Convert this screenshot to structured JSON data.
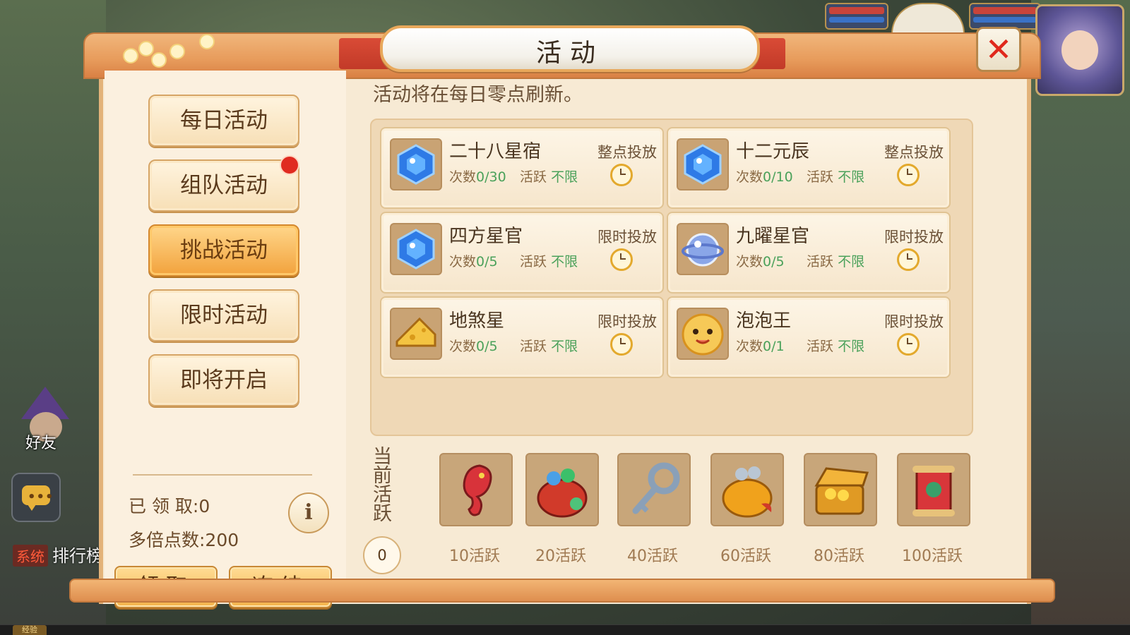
{
  "dialog": {
    "title": "活动",
    "notice": "活动将在每日零点刷新。"
  },
  "sidebar": {
    "tabs": [
      {
        "label": "每日活动",
        "active": false,
        "badge": false
      },
      {
        "label": "组队活动",
        "active": false,
        "badge": true
      },
      {
        "label": "挑战活动",
        "active": true,
        "badge": false
      },
      {
        "label": "限时活动",
        "active": false,
        "badge": false
      },
      {
        "label": "即将开启",
        "active": false,
        "badge": false
      }
    ],
    "claimed": "已 领 取:0",
    "multiplier": "多倍点数:200",
    "info_glyph": "i",
    "claim_button": "领取",
    "freeze_button": "冻结"
  },
  "activities": [
    {
      "name": "二十八星宿",
      "count_label": "次数",
      "count": "0/30",
      "active_label": "活跃",
      "active_value": "不限",
      "tag": "整点投放",
      "icon": "blue-gem-icon"
    },
    {
      "name": "十二元辰",
      "count_label": "次数",
      "count": "0/10",
      "active_label": "活跃",
      "active_value": "不限",
      "tag": "整点投放",
      "icon": "blue-gem-icon"
    },
    {
      "name": "四方星官",
      "count_label": "次数",
      "count": "0/5",
      "active_label": "活跃",
      "active_value": "不限",
      "tag": "限时投放",
      "icon": "blue-gem-icon"
    },
    {
      "name": "九曜星官",
      "count_label": "次数",
      "count": "0/5",
      "active_label": "活跃",
      "active_value": "不限",
      "tag": "限时投放",
      "icon": "orb-icon"
    },
    {
      "name": "地煞星",
      "count_label": "次数",
      "count": "0/5",
      "active_label": "活跃",
      "active_value": "不限",
      "tag": "限时投放",
      "icon": "cheese-icon"
    },
    {
      "name": "泡泡王",
      "count_label": "次数",
      "count": "0/1",
      "active_label": "活跃",
      "active_value": "不限",
      "tag": "限时投放",
      "icon": "bubble-face-icon"
    }
  ],
  "rewards": {
    "current_label": "当前活跃",
    "current_value": "0",
    "items": [
      {
        "label": "10活跃",
        "icon": "seahorse-icon"
      },
      {
        "label": "20活跃",
        "icon": "gem-bag-icon"
      },
      {
        "label": "40活跃",
        "icon": "key-icon"
      },
      {
        "label": "60活跃",
        "icon": "coin-pot-icon"
      },
      {
        "label": "80活跃",
        "icon": "treasure-chest-icon"
      },
      {
        "label": "100活跃",
        "icon": "scroll-icon"
      }
    ]
  },
  "hud": {
    "friend_label": "好友",
    "system_tag": "系统",
    "rank_text": "排行榜",
    "exp_label": "经验"
  },
  "colors": {
    "active_value": "#4aa15a",
    "close_x": "#e0281c",
    "badge": "#e02a20",
    "active_tab": "#f2a23c"
  }
}
